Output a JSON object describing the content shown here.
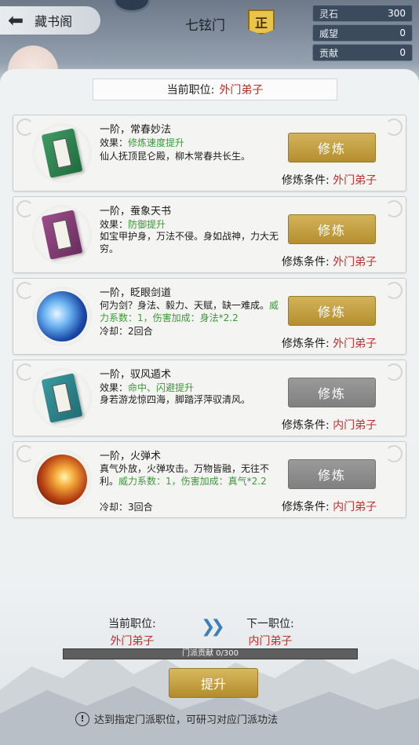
{
  "header": {
    "back_label": "藏书阁",
    "sect_name": "七铉门",
    "rank_badge": "正",
    "resources": [
      {
        "label": "灵石",
        "value": "300"
      },
      {
        "label": "威望",
        "value": "0"
      },
      {
        "label": "贡献",
        "value": "0"
      }
    ]
  },
  "current_position": {
    "label": "当前职位:",
    "value": "外门弟子"
  },
  "skills": [
    {
      "icon": "book-green-icon",
      "title": "一阶，常春妙法",
      "effect_label": "效果：",
      "effect_value": "修炼速度提升",
      "desc": "仙人抚顶昆仑殿，柳木常春共长生。",
      "button": "修炼",
      "button_state": "enabled",
      "cond_label": "修炼条件:",
      "cond_value": "外门弟子"
    },
    {
      "icon": "book-purple-icon",
      "title": "一阶，蚕象天书",
      "effect_label": "效果：",
      "effect_value": "防御提升",
      "desc": "如宝甲护身，万法不侵。身如战神，力大无穷。",
      "button": "修炼",
      "button_state": "enabled",
      "cond_label": "修炼条件:",
      "cond_value": "外门弟子"
    },
    {
      "icon": "sword-skill-icon",
      "title": "一阶，眨眼剑道",
      "desc": "何为剑？身法、毅力、天赋，缺一难成。",
      "power_text": "威力系数：1，伤害加成：身法*2.2",
      "cooldown": "冷却：2回合",
      "button": "修炼",
      "button_state": "enabled",
      "cond_label": "修炼条件:",
      "cond_value": "外门弟子"
    },
    {
      "icon": "book-teal-icon",
      "title": "一阶，驭风遁术",
      "effect_label": "效果：",
      "effect_value": "命中、闪避提升",
      "desc": "身若游龙惊四海，脚踏浮萍驭清风。",
      "button": "修炼",
      "button_state": "disabled",
      "cond_label": "修炼条件:",
      "cond_value": "内门弟子"
    },
    {
      "icon": "fireball-skill-icon",
      "title": "一阶，火弹术",
      "desc": "真气外放，火弹攻击。万物皆融，无往不利。",
      "power_text": "威力系数：1，伤害加成：真气*2.2",
      "cooldown": "冷却：3回合",
      "button": "修炼",
      "button_state": "disabled",
      "cond_label": "修炼条件:",
      "cond_value": "内门弟子"
    }
  ],
  "promotion": {
    "current_label": "当前职位:",
    "current_value": "外门弟子",
    "next_label": "下一职位:",
    "next_value": "内门弟子",
    "progress_text": "门派贡献 0/300",
    "progress_fraction": 0,
    "button": "提升",
    "hint": "达到指定门派职位，可研习对应门派功法"
  },
  "colors": {
    "accent_gold": "#c2a044",
    "danger_red": "#c0302b",
    "effect_green": "#3a9a35",
    "disabled_grey": "#8c8c8c"
  }
}
